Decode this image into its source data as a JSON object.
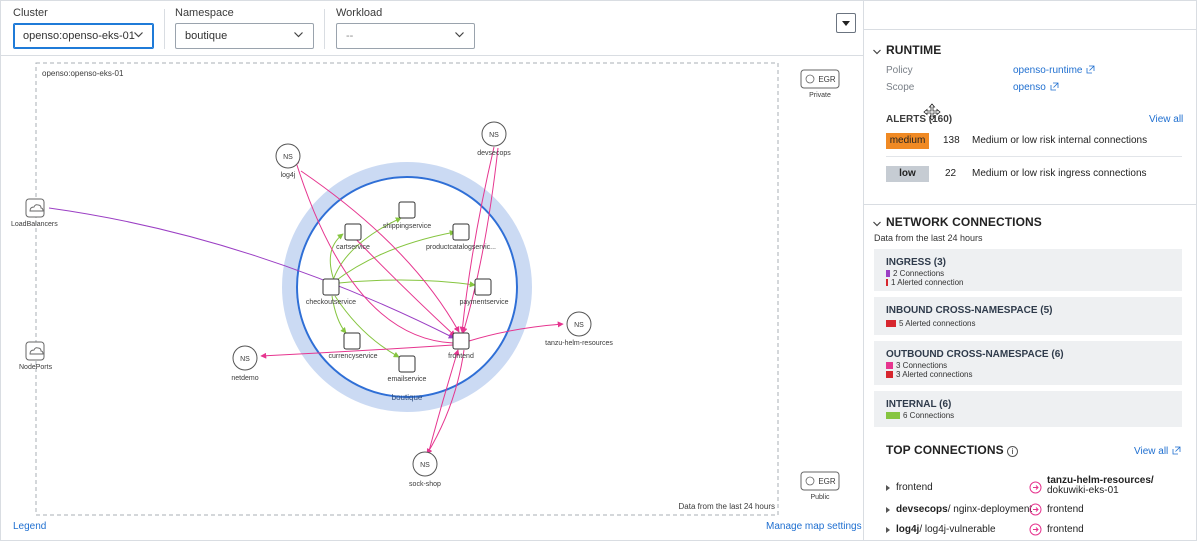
{
  "filters": {
    "cluster": {
      "label": "Cluster",
      "value": "openso:openso-eks-01"
    },
    "namespace": {
      "label": "Namespace",
      "value": "boutique"
    },
    "workload": {
      "label": "Workload",
      "value": "--"
    }
  },
  "map": {
    "cluster_label": "openso:openso-eks-01",
    "namespace_ring_label": "boutique",
    "data_note": "Data from the last 24 hours",
    "egress_private": {
      "badge": "EGR",
      "label": "Private"
    },
    "egress_public": {
      "badge": "EGR",
      "label": "Public"
    },
    "external_nodes": [
      {
        "label": "LoadBalancers",
        "icon": "cloud-icon"
      },
      {
        "label": "NodePorts",
        "icon": "cloud-icon"
      }
    ],
    "namespace_badge": "NS",
    "namespace_nodes": [
      "log4j",
      "devsecops",
      "netdemo",
      "tanzu-helm-resources",
      "sock-shop"
    ],
    "services": [
      "shippingservice",
      "cartservice",
      "productcatalogservic...",
      "checkoutservice",
      "paymentservice",
      "currencyservice",
      "frontend",
      "emailservice"
    ],
    "legend_link": "Legend",
    "manage_link": "Manage map settings"
  },
  "colors": {
    "ingress": "#9b3fc4",
    "cross_namespace": "#e6358f",
    "internal": "#86c540",
    "alerted": "#d7262e",
    "ring": "#2f6fd6",
    "ring_halo": "#cbdaf3",
    "link": "#1f6fd0"
  },
  "runtime": {
    "title": "RUNTIME",
    "policy_key": "Policy",
    "policy_value": "openso-runtime",
    "scope_key": "Scope",
    "scope_value": "openso",
    "alerts_title": "ALERTS (160)",
    "view_all": "View all",
    "alerts": [
      {
        "severity": "medium",
        "count": "138",
        "description": "Medium or low risk internal connections"
      },
      {
        "severity": "low",
        "count": "22",
        "description": "Medium or low risk ingress connections"
      }
    ]
  },
  "network": {
    "title": "NETWORK CONNECTIONS",
    "subtitle": "Data from the last 24 hours",
    "groups": [
      {
        "title": "INGRESS (3)",
        "lines": [
          {
            "text": "2 Connections",
            "color": "#9b3fc4"
          },
          {
            "text": "1 Alerted connection",
            "color": "#d7262e"
          }
        ]
      },
      {
        "title": "INBOUND CROSS-NAMESPACE (5)",
        "lines": [
          {
            "text": "5 Alerted connections",
            "color": "#d7262e"
          }
        ]
      },
      {
        "title": "OUTBOUND CROSS-NAMESPACE (6)",
        "lines": [
          {
            "text": "3 Connections",
            "color": "#e6358f"
          },
          {
            "text": "3 Alerted connections",
            "color": "#d7262e"
          }
        ]
      },
      {
        "title": "INTERNAL (6)",
        "lines": [
          {
            "text": "6 Connections",
            "color": "#86c540"
          }
        ]
      }
    ]
  },
  "top_connections": {
    "title": "TOP CONNECTIONS",
    "view_all": "View all",
    "rows": [
      {
        "src_bold": "",
        "src": "frontend",
        "dst_bold": "tanzu-helm-resources/",
        "dst": "dokuwiki-eks-01"
      },
      {
        "src_bold": "devsecops",
        "src": "/ nginx-deployment",
        "dst_bold": "",
        "dst": "frontend"
      },
      {
        "src_bold": "log4j",
        "src": "/ log4j-vulnerable",
        "dst_bold": "",
        "dst": "frontend"
      }
    ]
  }
}
